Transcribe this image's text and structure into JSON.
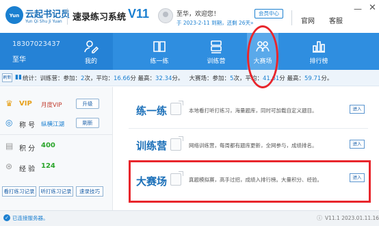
{
  "app": {
    "logo_char": "Yun",
    "name": "云起书记员",
    "name_en": "Yun Qi Shu Ji Yuan",
    "system_name": "速录练习系统",
    "version_label": "V11"
  },
  "header": {
    "greeting": "至华，欢迎您！",
    "expire_text": "于 2023-2-11 到期，还剩 26天»",
    "member_center": "会员中心",
    "site_link": "官网",
    "service_link": "客服",
    "minimize": "—",
    "close": "✕"
  },
  "user": {
    "phone": "18307023437",
    "name": "至华"
  },
  "nav": {
    "items": [
      {
        "label": "我的",
        "icon": "user-edit-icon"
      },
      {
        "label": "练一练",
        "icon": "book-icon"
      },
      {
        "label": "训练营",
        "icon": "cabinet-icon"
      },
      {
        "label": "大赛场",
        "icon": "group-icon"
      },
      {
        "label": "排行榜",
        "icon": "bar-chart-icon"
      }
    ]
  },
  "stats": {
    "refresh": "刷新",
    "prefix": "统计：训练营：",
    "camp_count_label": "参加：",
    "camp_count": "2",
    "camp_avg_label": "次，平均：",
    "camp_avg": "16.66",
    "camp_max_label": "分 最高：",
    "camp_max": "32.34",
    "camp_unit": "分。",
    "arena_label": "大赛场：",
    "arena_count_label": "参加：",
    "arena_count": "5",
    "arena_avg_label": "次，平均：",
    "arena_avg": "41.61",
    "arena_max_label": "分 最高：",
    "arena_max": "59.71",
    "arena_unit": "分。"
  },
  "left_panel": {
    "vip_label": "VIP",
    "vip_value": "月度VIP",
    "vip_button": "升级",
    "title_label": "称 号",
    "title_value": "纵横江湖",
    "title_button": "刷新",
    "points_label": "积 分",
    "points_value": "400",
    "exp_label": "经 验",
    "exp_value": "124",
    "bottom_buttons": [
      "看打练习记录",
      "听打练习记录",
      "速录技巧"
    ]
  },
  "cards": [
    {
      "title": "练一练",
      "desc": "本地看打听打练习，海量题库，同时可加载自定义题目。",
      "button": "进入"
    },
    {
      "title": "训练营",
      "desc": "网络训练营，每周都有题库更新，全网参与，成绩排名。",
      "button": "进入"
    },
    {
      "title": "大赛场",
      "desc": "真题模拟赛，高手过招，成绩入排行榜。大量积分、经验。",
      "button": "进入"
    }
  ],
  "status": {
    "connection": "已连接服务器。",
    "version": "V11.1 2023.01.11.16"
  },
  "colors": {
    "brand_blue": "#1a7fd0",
    "nav_bar": "#2f8ee0",
    "highlight_red": "#e8262c",
    "vip_gold": "#e6a019",
    "points_green": "#2aa52a"
  }
}
